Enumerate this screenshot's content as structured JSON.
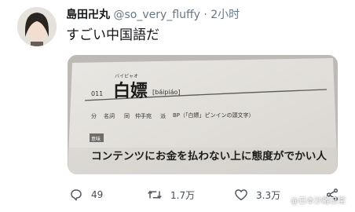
{
  "tweet": {
    "display_name": "島田卍丸",
    "handle": "@so_very_fluffy",
    "separator": "·",
    "time": "2小时",
    "text": "すごい中国語だ"
  },
  "photo": {
    "entry_number": "011",
    "headword": "白嫖",
    "ruby": "バイピャオ",
    "pinyin": "[báipiáo]",
    "pos_marks": [
      "分",
      "名詞",
      "同",
      "仲手宛",
      "派",
      "BP（「白嫖」ピンインの頭文字）"
    ],
    "sense_tag": "意味",
    "definition": "コンテンツにお金を払わない上に態度がでかい人"
  },
  "actions": {
    "reply_count": "49",
    "retweet_count": "1.7万",
    "like_count": "3.3万"
  },
  "watermark": "@日本沙雕日常",
  "colors": {
    "text": "#14171a",
    "secondary": "#657786",
    "icon": "#55595e"
  }
}
